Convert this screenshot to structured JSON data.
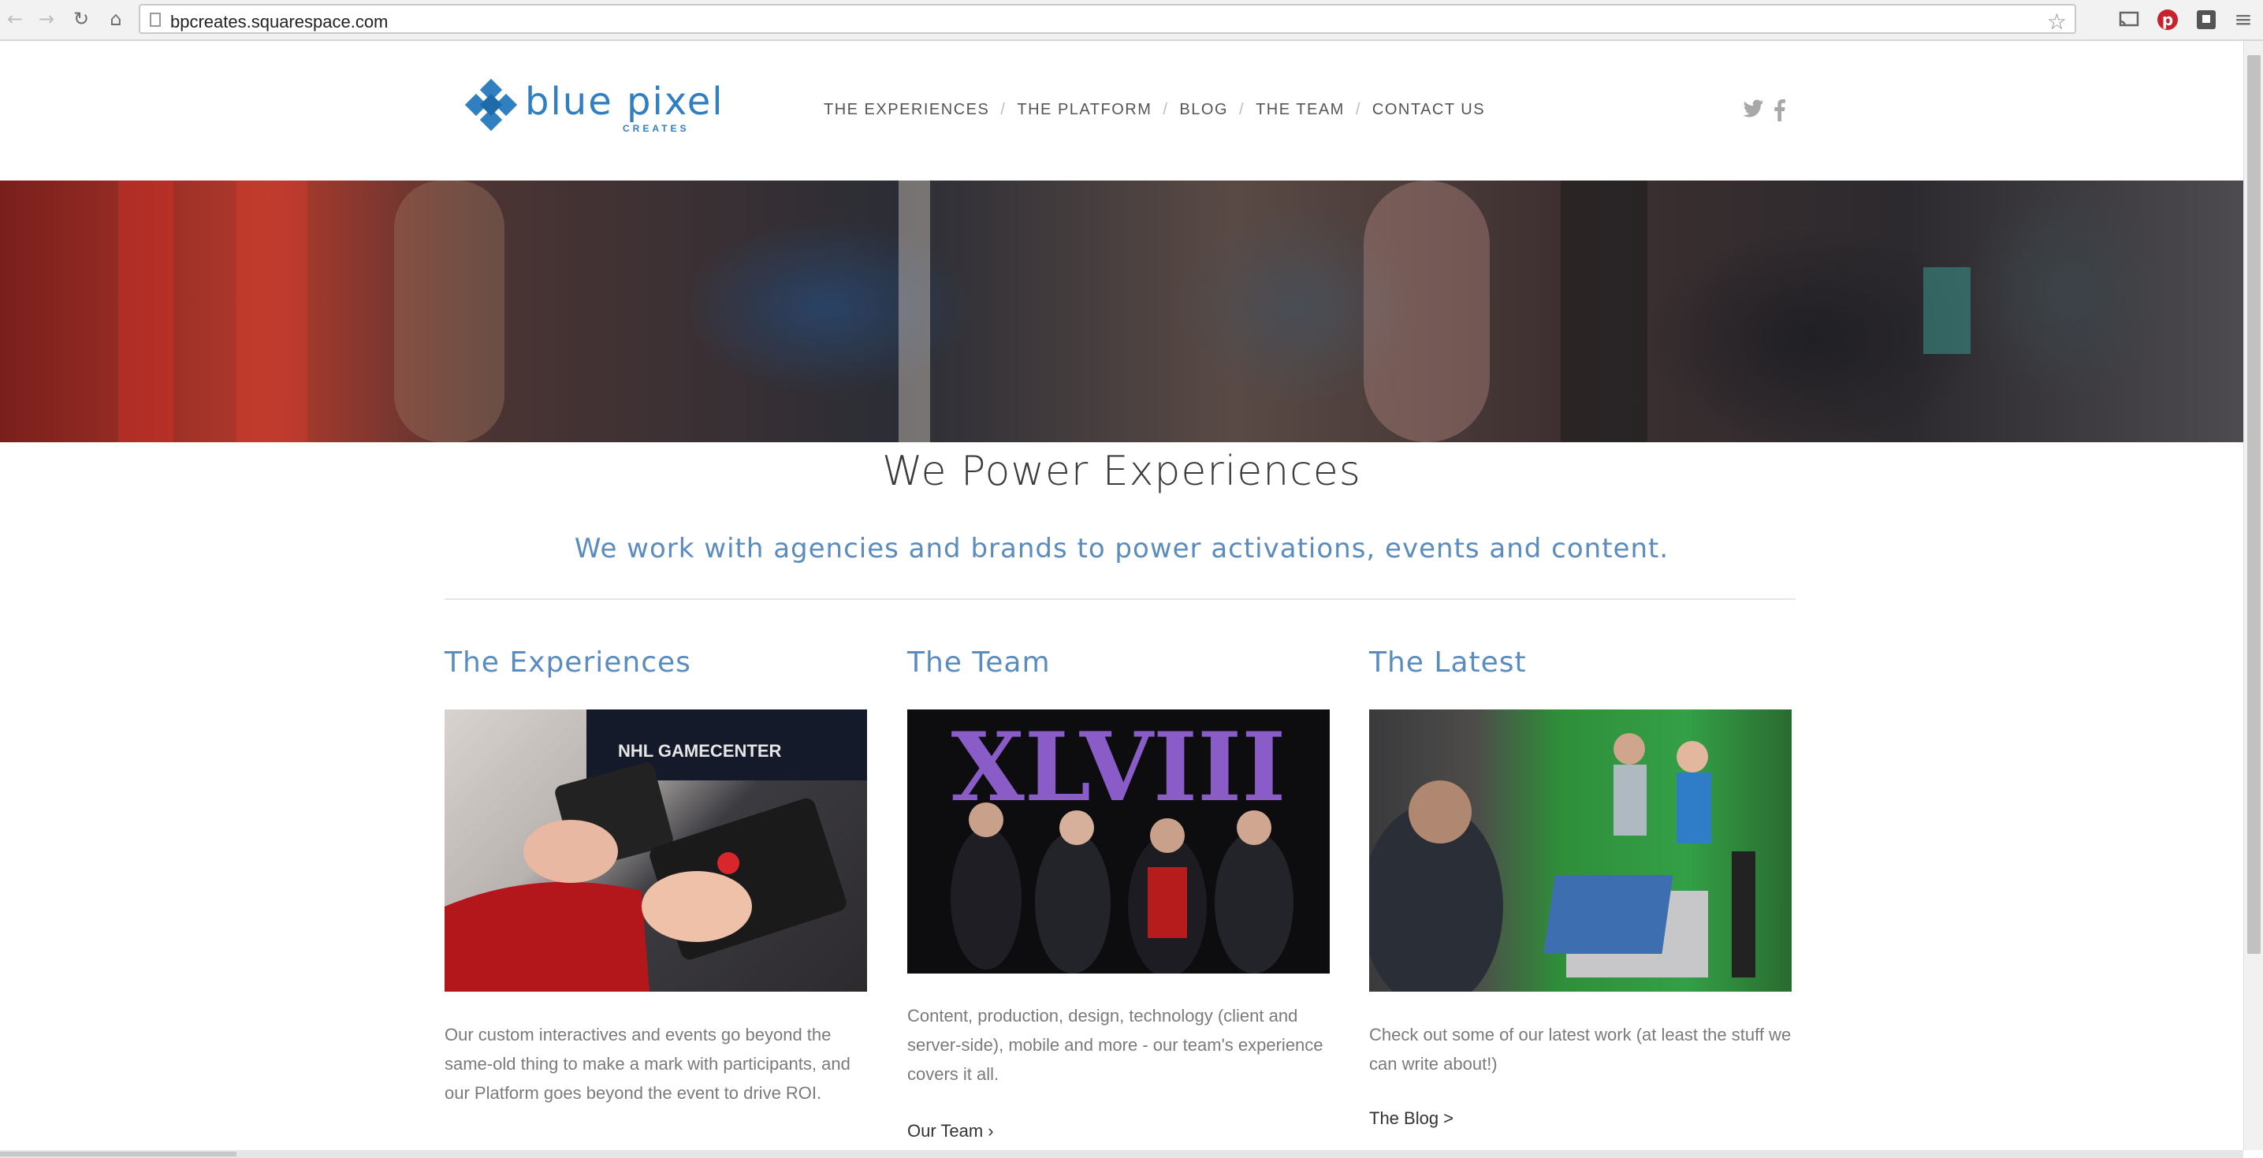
{
  "browser": {
    "url": "bpcreates.squarespace.com",
    "back_icon": "←",
    "forward_icon": "→",
    "reload_icon": "↻",
    "home_icon": "⌂",
    "star_icon": "☆",
    "menu_icon": "≡"
  },
  "site": {
    "logo_text": "blue pixel",
    "logo_sub": "CREATES",
    "brand_color": "#2f7fc1",
    "nav": [
      "THE EXPERIENCES",
      "THE PLATFORM",
      "BLOG",
      "THE TEAM",
      "CONTACT US"
    ],
    "nav_separator": "/",
    "social": {
      "twitter_icon": "🐦",
      "facebook_icon": "f"
    }
  },
  "main": {
    "headline": "We Power Experiences",
    "subhead": "We work with agencies and brands to power activations, events and content.",
    "columns": [
      {
        "title": "The Experiences",
        "image_alt": "NHL GAMECENTER",
        "body": "Our custom interactives and events go beyond the same-old thing to make a mark with participants, and our Platform goes beyond the event to drive ROI.",
        "link": ""
      },
      {
        "title": "The Team",
        "image_alt": "XLVIII",
        "body": "Content, production, design, technology (client and server-side), mobile and more - our team's experience covers it all.",
        "link": "Our Team ›"
      },
      {
        "title": "The Latest",
        "image_alt": "",
        "body": "Check out some of our latest work (at least the stuff we can write about!)",
        "link": "The Blog >"
      }
    ]
  }
}
